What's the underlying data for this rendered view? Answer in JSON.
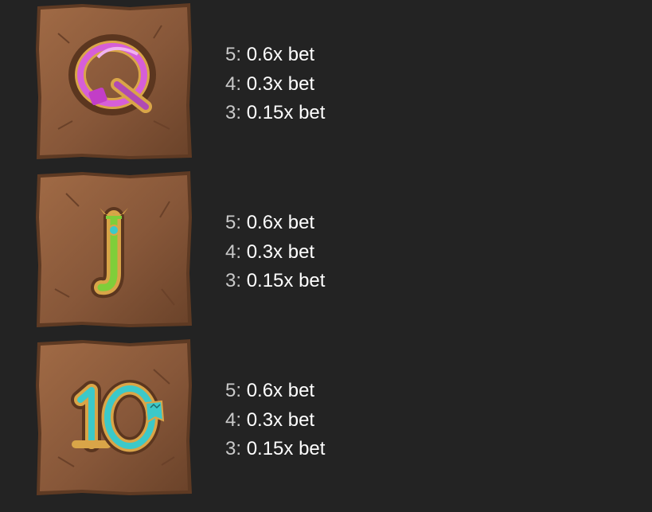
{
  "symbols": [
    {
      "letter": "Q",
      "icon": "q-symbol-icon",
      "payouts": [
        {
          "count": "5:",
          "value": "0.6x bet"
        },
        {
          "count": "4:",
          "value": "0.3x bet"
        },
        {
          "count": "3:",
          "value": "0.15x bet"
        }
      ]
    },
    {
      "letter": "J",
      "icon": "j-symbol-icon",
      "payouts": [
        {
          "count": "5:",
          "value": "0.6x bet"
        },
        {
          "count": "4:",
          "value": "0.3x bet"
        },
        {
          "count": "3:",
          "value": "0.15x bet"
        }
      ]
    },
    {
      "letter": "10",
      "icon": "ten-symbol-icon",
      "payouts": [
        {
          "count": "5:",
          "value": "0.6x bet"
        },
        {
          "count": "4:",
          "value": "0.3x bet"
        },
        {
          "count": "3:",
          "value": "0.15x bet"
        }
      ]
    }
  ],
  "colors": {
    "background": "#232323",
    "tile_base": "#8a5a3b",
    "tile_dark": "#5e3a23",
    "tile_light": "#a46d47",
    "gold": "#d9a548",
    "q_accent": "#d65fd8",
    "j_accent": "#7fce3a",
    "ten_accent": "#3cc9c9",
    "count_text": "#c9c9c9",
    "value_text": "#ffffff"
  }
}
